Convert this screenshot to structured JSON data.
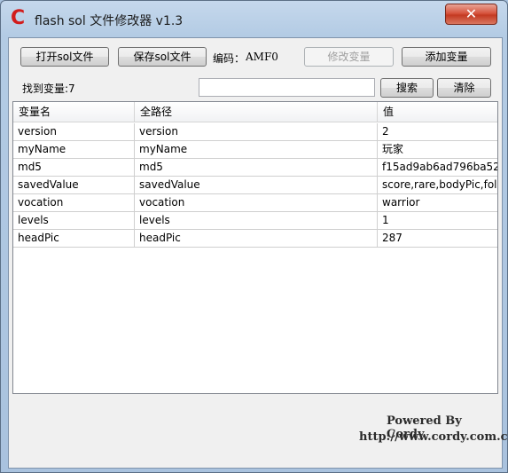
{
  "window": {
    "title": "flash sol 文件修改器 v1.3",
    "close_label": "✕",
    "app_icon_glyph": "C"
  },
  "toolbar": {
    "open_label": "打开sol文件",
    "save_label": "保存sol文件",
    "encoding_label": "编码：",
    "encoding_value": "AMF0",
    "modify_label": "修改变量",
    "add_label": "添加变量"
  },
  "search": {
    "found_label": "找到变量:7",
    "input_value": "",
    "search_label": "搜索",
    "clear_label": "清除"
  },
  "table": {
    "columns": [
      "变量名",
      "全路径",
      "值"
    ],
    "rows": [
      [
        "version",
        "version",
        "2"
      ],
      [
        "myName",
        "myName",
        "玩家"
      ],
      [
        "md5",
        "md5",
        "f15ad9ab6ad796ba52"
      ],
      [
        "savedValue",
        "savedValue",
        "score,rare,bodyPic,follo"
      ],
      [
        "vocation",
        "vocation",
        "warrior"
      ],
      [
        "levels",
        "levels",
        "1"
      ],
      [
        "headPic",
        "headPic",
        "287"
      ]
    ]
  },
  "footer": {
    "powered": "Powered By Cordy",
    "website": "http://www.cordy.com.cn"
  },
  "colors": {
    "icon_red": "#d21c1c",
    "close_red": "#c43a22",
    "frame_blue": "#a9c2de"
  },
  "icons": {
    "app": "app-logo-icon",
    "close": "close-icon"
  }
}
